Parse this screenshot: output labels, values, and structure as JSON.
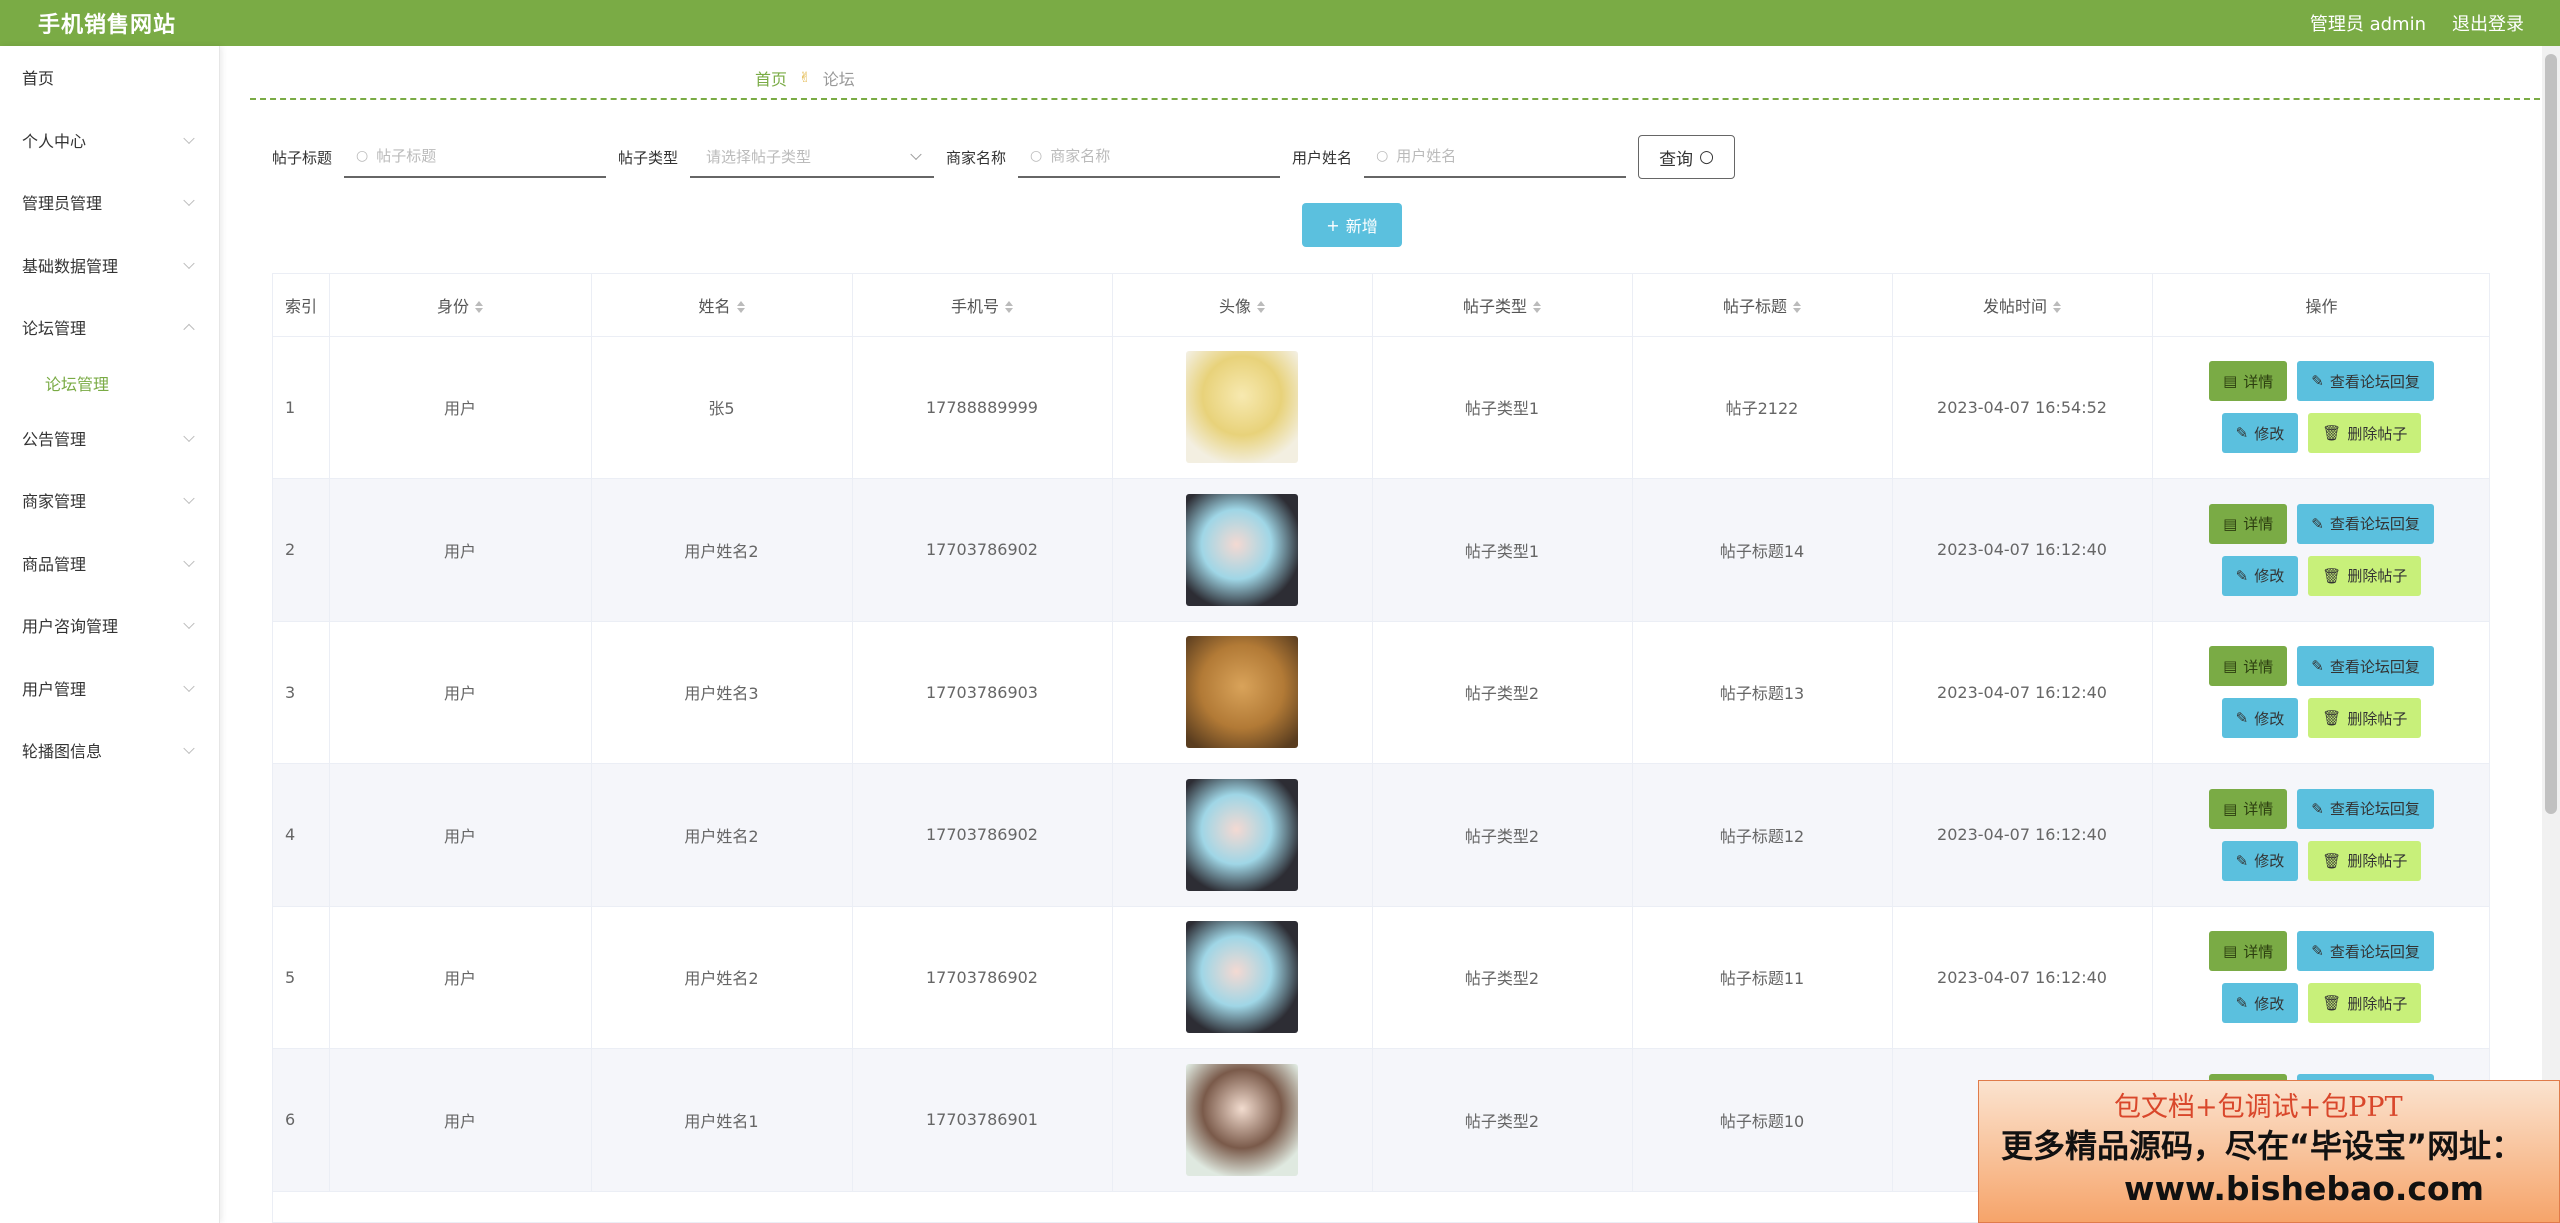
{
  "header": {
    "title": "手机销售网站",
    "user_label": "管理员 admin",
    "logout_label": "退出登录"
  },
  "sidebar": {
    "items": [
      {
        "label": "首页"
      },
      {
        "label": "个人中心"
      },
      {
        "label": "管理员管理"
      },
      {
        "label": "基础数据管理"
      },
      {
        "label": "论坛管理"
      },
      {
        "label": "公告管理"
      },
      {
        "label": "商家管理"
      },
      {
        "label": "商品管理"
      },
      {
        "label": "用户咨询管理"
      },
      {
        "label": "用户管理"
      },
      {
        "label": "轮播图信息"
      }
    ],
    "sub_active": "论坛管理"
  },
  "breadcrumb": {
    "home": "首页",
    "current": "论坛"
  },
  "search": {
    "title_label": "帖子标题",
    "title_placeholder": "帖子标题",
    "type_label": "帖子类型",
    "type_placeholder": "请选择帖子类型",
    "shop_label": "商家名称",
    "shop_placeholder": "商家名称",
    "user_label": "用户姓名",
    "user_placeholder": "用户姓名",
    "query_label": "查询"
  },
  "add_label": "新增",
  "table": {
    "headers": [
      "索引",
      "身份",
      "姓名",
      "手机号",
      "头像",
      "帖子类型",
      "帖子标题",
      "发帖时间",
      "操作"
    ],
    "rows": [
      {
        "index": "1",
        "identity": "用户",
        "name": "张5",
        "phone": "17788889999",
        "type": "帖子类型1",
        "title": "帖子2122",
        "time": "2023-04-07 16:54:52"
      },
      {
        "index": "2",
        "identity": "用户",
        "name": "用户姓名2",
        "phone": "17703786902",
        "type": "帖子类型1",
        "title": "帖子标题14",
        "time": "2023-04-07 16:12:40"
      },
      {
        "index": "3",
        "identity": "用户",
        "name": "用户姓名3",
        "phone": "17703786903",
        "type": "帖子类型2",
        "title": "帖子标题13",
        "time": "2023-04-07 16:12:40"
      },
      {
        "index": "4",
        "identity": "用户",
        "name": "用户姓名2",
        "phone": "17703786902",
        "type": "帖子类型2",
        "title": "帖子标题12",
        "time": "2023-04-07 16:12:40"
      },
      {
        "index": "5",
        "identity": "用户",
        "name": "用户姓名2",
        "phone": "17703786902",
        "type": "帖子类型2",
        "title": "帖子标题11",
        "time": "2023-04-07 16:12:40"
      },
      {
        "index": "6",
        "identity": "用户",
        "name": "用户姓名1",
        "phone": "17703786901",
        "type": "帖子类型2",
        "title": "帖子标题10",
        "time": "2023-"
      }
    ],
    "actions": {
      "detail": "详情",
      "reply": "查看论坛回复",
      "edit": "修改",
      "delete": "删除帖子"
    }
  },
  "watermark": {
    "line1": "包文档+包调试+包PPT",
    "line2": "更多精品源码，尽在“毕设宝”网址：",
    "line3": "www.bishebao.com"
  },
  "colors": {
    "primary": "#7aab45",
    "info": "#5bc0de",
    "danger_light": "#c8f07a"
  }
}
